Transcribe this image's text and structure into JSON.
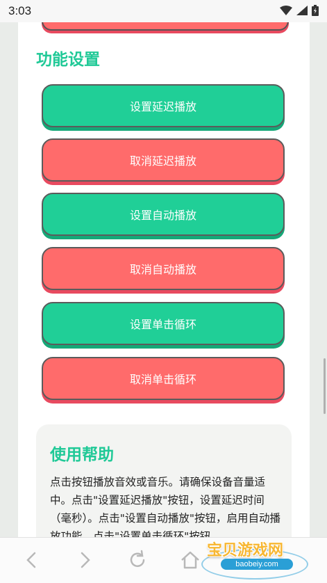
{
  "status_bar": {
    "time": "3:03"
  },
  "settings": {
    "title": "功能设置",
    "buttons": [
      {
        "label": "设置延迟播放",
        "color": "#20cf97"
      },
      {
        "label": "取消延迟播放",
        "color": "#ff6b6b"
      },
      {
        "label": "设置自动播放",
        "color": "#20cf97"
      },
      {
        "label": "取消自动播放",
        "color": "#ff6b6b"
      },
      {
        "label": "设置单击循环",
        "color": "#20cf97"
      },
      {
        "label": "取消单击循环",
        "color": "#ff6b6b"
      }
    ]
  },
  "help": {
    "title": "使用帮助",
    "text": "点击按钮播放音效或音乐。请确保设备音量适中。点击\"设置延迟播放\"按钮，设置延迟时间（毫秒）。点击\"设置自动播放\"按钮，启用自动播放功能。点击\"设置单击循环\"按钮"
  },
  "watermark": {
    "brand": "宝贝游戏网",
    "url": "baobeiy.com"
  },
  "colors": {
    "accent": "#20c997",
    "green_button": "#20cf97",
    "red_button": "#ff6b6b"
  },
  "nav": {
    "icons": [
      "back-icon",
      "forward-icon",
      "refresh-icon",
      "home-icon"
    ]
  }
}
